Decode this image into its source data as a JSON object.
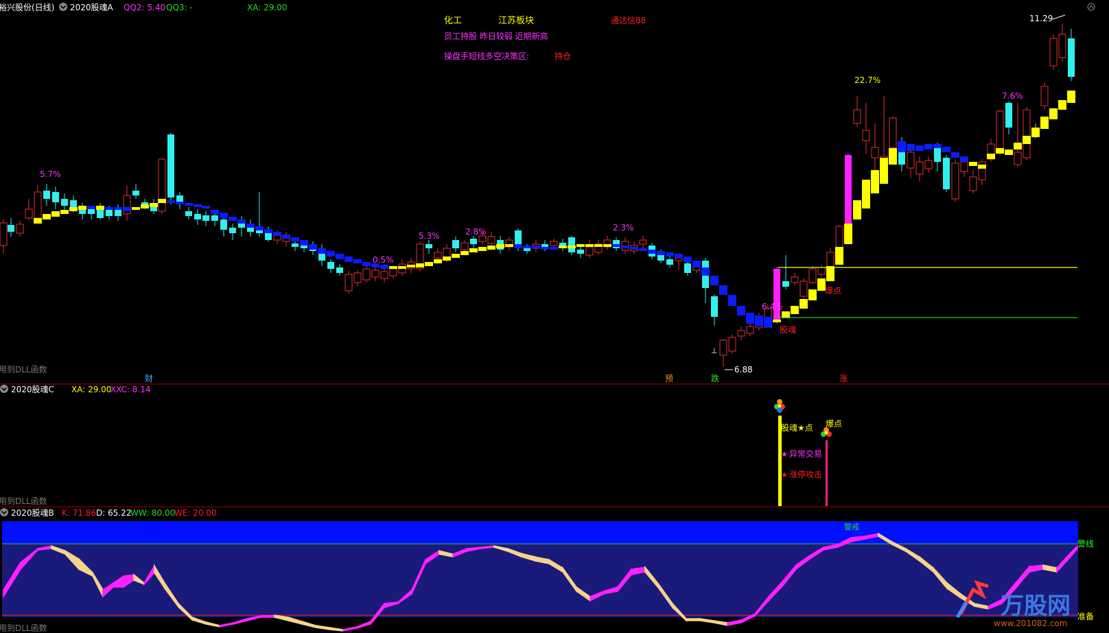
{
  "colors": {
    "up": "#e63030",
    "down_cyan": "#2ff0f0",
    "ma_blue": "#0a1cff",
    "ma_yellow": "#ffff00",
    "magenta": "#ff20ff",
    "panel_border": "#aa0000",
    "navy_band": "#1a1a7a",
    "blue_band": "#0010ff",
    "cream_line": "#f5d38a",
    "green_line": "#26c826",
    "red_line": "#ff2020",
    "white": "#ffffff"
  },
  "panel_a": {
    "stock_name": "裕兴股份(日线)",
    "indicator_name": "2020股魂A",
    "qq2": "QQ2: 5.40",
    "qq3": "QQ3: -",
    "xa": "XA: 29.00",
    "sector": "化工",
    "region": "江苏板块",
    "source": "通达信88",
    "tags": "员工持股 昨日较弱 近期新高",
    "decision_label": "操盘手短线多空决策区:",
    "decision_value": "持仓",
    "dll_note": "用到DLL函数",
    "pct_labels": [
      "5.7%",
      "0.5%",
      "5.3%",
      "2.8%",
      "2.3%",
      "6.4%",
      "22.7%",
      "7.6%"
    ],
    "high_label": "11.29",
    "low_label": "6.88",
    "signal_gh": "股魂",
    "signal_bd": "爆点",
    "bottom_markers": [
      "财",
      "预",
      "跌",
      "涨"
    ]
  },
  "panel_c": {
    "indicator_name": "2020股魂C",
    "xa": "XA: 29.00",
    "xxc": "XXC: 8.14",
    "label_star": "股魂★点",
    "label_abnormal": "异常交易",
    "label_limit": "涨停攻击",
    "label_burst": "爆点",
    "dll_note": "用到DLL函数"
  },
  "panel_b": {
    "indicator_name": "2020股魂B",
    "k": "K: 71.86",
    "d": "D: 65.22",
    "ww": "WW: 80.00",
    "we": "WE: 20.00",
    "warn_top": "警戒",
    "warn_line": "警线",
    "ready": "准备",
    "dll_note": "用到DLL函数"
  },
  "watermark": {
    "brand": "万股网",
    "site": "www.201082.com"
  },
  "chart_data": {
    "type": "candlestick",
    "title": "",
    "series": [
      {
        "name": "KD",
        "values": [
          71.86,
          65.22
        ]
      }
    ]
  }
}
